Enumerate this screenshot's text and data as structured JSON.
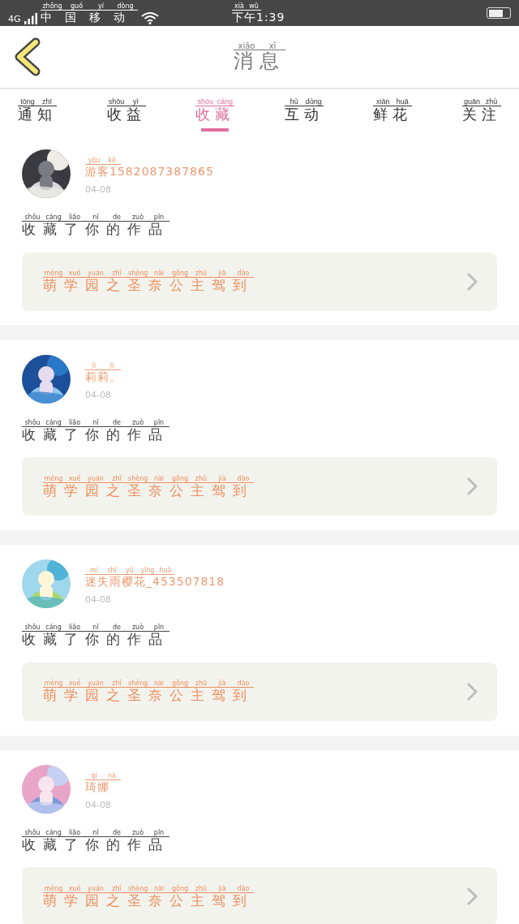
{
  "status_bar": {
    "network": "4G",
    "carrier": "中国移动",
    "carrier_pinyin": "zhōng guó yí dòng",
    "time": "下午1:39",
    "time_pinyin": "xià wǔ"
  },
  "header": {
    "title": "消息",
    "title_pinyin": "xiāo xī"
  },
  "tabs": [
    {
      "label": "通知",
      "pinyin": "tōng zhī",
      "selected": false
    },
    {
      "label": "收益",
      "pinyin": "shōu yì",
      "selected": false
    },
    {
      "label": "收藏",
      "pinyin": "shōu cáng",
      "selected": true
    },
    {
      "label": "互动",
      "pinyin": "hù dòng",
      "selected": false
    },
    {
      "label": "鲜花",
      "pinyin": "xiān huā",
      "selected": false
    },
    {
      "label": "关注",
      "pinyin": "guān zhù",
      "selected": false
    }
  ],
  "items": [
    {
      "name": "游客1582087387865",
      "name_pinyin": "yóu kè",
      "date": "04-08",
      "action": "收藏了你的作品",
      "action_pinyin": "shōu cáng liǎo nǐ de zuò pǐn",
      "work": "萌学园之圣奈公主驾到",
      "work_pinyin": "méng xué yuán zhī shèng nài gōng zhǔ jià dào"
    },
    {
      "name": "莉莉。",
      "name_pinyin": "lì lì",
      "date": "04-08",
      "action": "收藏了你的作品",
      "action_pinyin": "shōu cáng liǎo nǐ de zuò pǐn",
      "work": "萌学园之圣奈公主驾到",
      "work_pinyin": "méng xué yuán zhī shèng nài gōng zhǔ jià dào"
    },
    {
      "name": "迷失雨樱花_453507818",
      "name_pinyin": "mí shī yǔ yīng huā",
      "date": "04-08",
      "action": "收藏了你的作品",
      "action_pinyin": "shōu cáng liǎo nǐ de zuò pǐn",
      "work": "萌学园之圣奈公主驾到",
      "work_pinyin": "méng xué yuán zhī shèng nài gōng zhǔ jià dào"
    },
    {
      "name": "琦娜",
      "name_pinyin": "qí nà",
      "date": "04-08",
      "action": "收藏了你的作品",
      "action_pinyin": "shōu cáng liǎo nǐ de zuò pǐn",
      "work": "萌学园之圣奈公主驾到",
      "work_pinyin": "méng xué yuán zhī shèng nài gōng zhǔ jià dào"
    }
  ]
}
